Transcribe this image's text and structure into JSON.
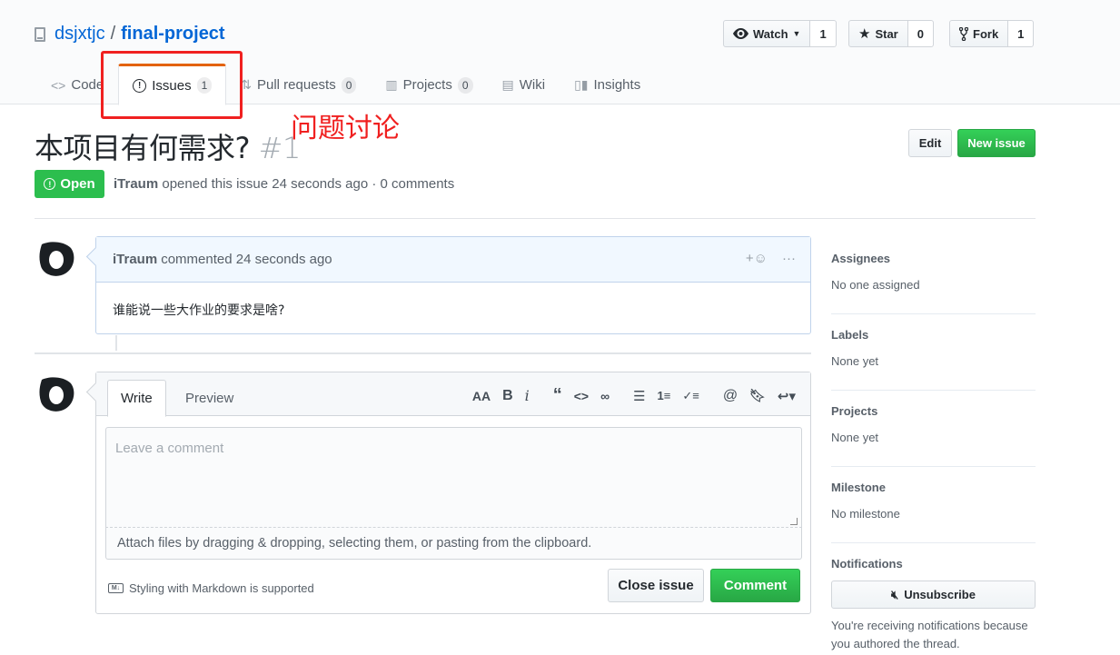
{
  "repo": {
    "owner": "dsjxtjc",
    "separator": "/",
    "name": "final-project"
  },
  "actions": {
    "watch_label": "Watch",
    "watch_count": "1",
    "star_label": "Star",
    "star_count": "0",
    "fork_label": "Fork",
    "fork_count": "1"
  },
  "tabs": [
    {
      "label": "Code"
    },
    {
      "label": "Issues",
      "count": "1"
    },
    {
      "label": "Pull requests",
      "count": "0"
    },
    {
      "label": "Projects",
      "count": "0"
    },
    {
      "label": "Wiki"
    },
    {
      "label": "Insights"
    }
  ],
  "annotation": {
    "text": "问题讨论",
    "color": "#f02020"
  },
  "issue": {
    "title": "本项目有何需求?",
    "number": "#1",
    "edit_label": "Edit",
    "new_issue_label": "New issue",
    "state": "Open",
    "author": "iTraum",
    "meta_text": "opened this issue 24 seconds ago · 0 comments"
  },
  "comment": {
    "author": "iTraum",
    "action_text": "commented 24 seconds ago",
    "body": "谁能说一些大作业的要求是啥?"
  },
  "form": {
    "write_tab": "Write",
    "preview_tab": "Preview",
    "placeholder": "Leave a comment",
    "attach_text": "Attach files by dragging & dropping, selecting them, or pasting from the clipboard.",
    "markdown_note": "Styling with Markdown is supported",
    "close_label": "Close issue",
    "comment_label": "Comment"
  },
  "sidebar": {
    "assignees_head": "Assignees",
    "assignees_val": "No one assigned",
    "labels_head": "Labels",
    "labels_val": "None yet",
    "projects_head": "Projects",
    "projects_val": "None yet",
    "milestone_head": "Milestone",
    "milestone_val": "No milestone",
    "notifications_head": "Notifications",
    "unsubscribe_label": "Unsubscribe",
    "notifications_note": "You're receiving notifications because you authored the thread."
  },
  "colors": {
    "accent_green": "#28a745",
    "link_blue": "#0366d6",
    "tab_orange": "#e36209"
  }
}
